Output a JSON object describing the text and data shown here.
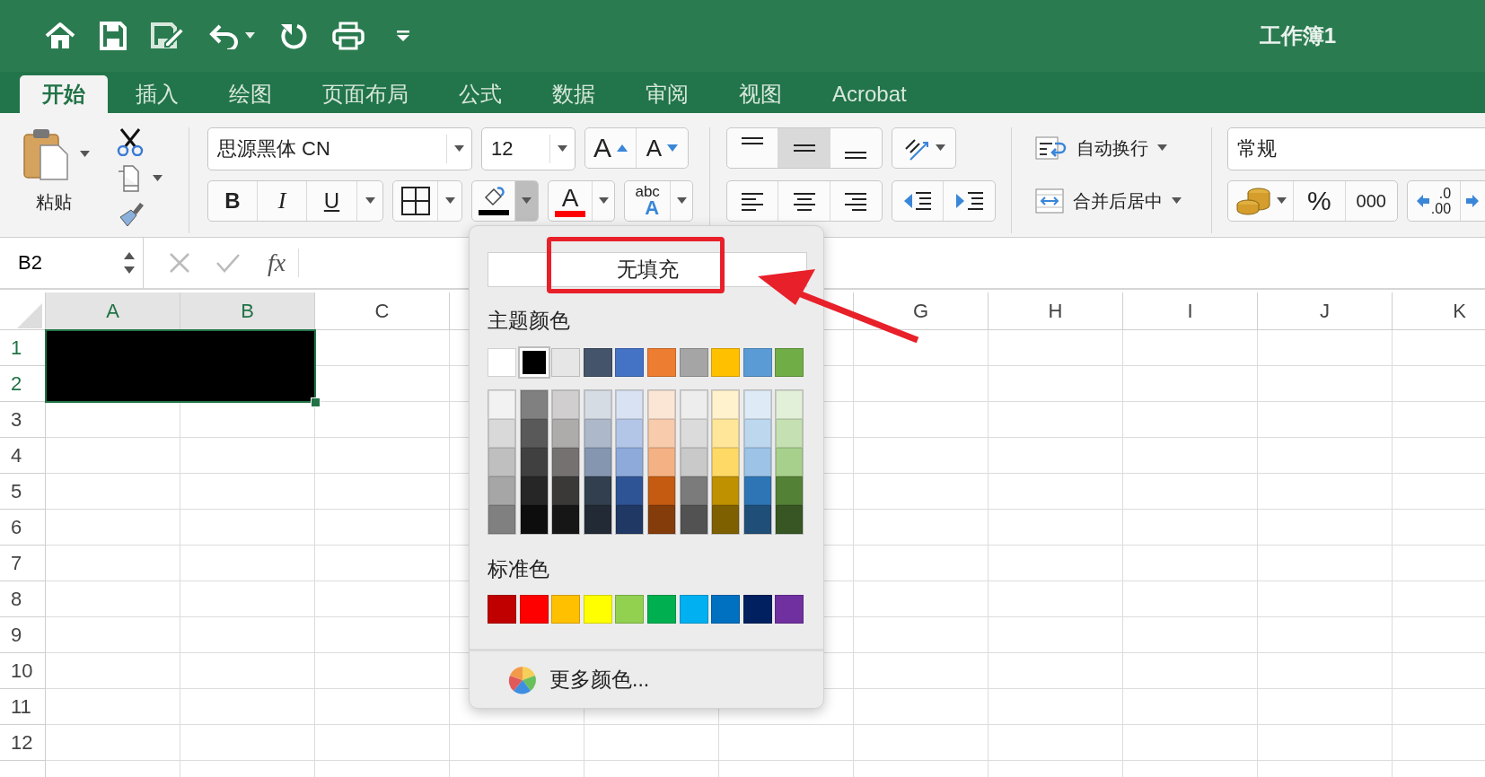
{
  "window": {
    "title": "工作簿1"
  },
  "tabs": [
    {
      "label": "开始",
      "selected": true
    },
    {
      "label": "插入",
      "selected": false
    },
    {
      "label": "绘图",
      "selected": false
    },
    {
      "label": "页面布局",
      "selected": false
    },
    {
      "label": "公式",
      "selected": false
    },
    {
      "label": "数据",
      "selected": false
    },
    {
      "label": "审阅",
      "selected": false
    },
    {
      "label": "视图",
      "selected": false
    },
    {
      "label": "Acrobat",
      "selected": false
    }
  ],
  "ribbon": {
    "paste": "粘贴",
    "font_name": "思源黑体 CN",
    "font_size": "12",
    "grow_font": "A",
    "shrink_font": "A",
    "bold": "B",
    "italic": "I",
    "underline": "U",
    "fill_color": {
      "color": "#000000",
      "open": true
    },
    "font_color": {
      "label": "A",
      "color": "#ff0000"
    },
    "text_effects": {
      "top": "abc",
      "bottom": "A"
    },
    "vertical_align": [
      {
        "selected": false
      },
      {
        "selected": true
      },
      {
        "selected": false
      }
    ],
    "wrap_text": "自动换行",
    "merge_center": "合并后居中",
    "number_format": "常规",
    "percent": "%",
    "thousands": "000",
    "decimal": {
      "top": ".0",
      "bottom": ".00"
    }
  },
  "formula_bar": {
    "name_box": "B2",
    "function": "fx"
  },
  "sheet": {
    "columns": [
      {
        "kind": "header",
        "label": "A",
        "selected": true
      },
      {
        "kind": "header",
        "label": "B",
        "selected": true
      },
      {
        "kind": "header",
        "label": "C",
        "selected": false
      },
      {
        "kind": "covered"
      },
      {
        "kind": "hidden"
      },
      {
        "kind": "covered"
      },
      {
        "kind": "header",
        "label": "G",
        "selected": false
      },
      {
        "kind": "header",
        "label": "H",
        "selected": false
      },
      {
        "kind": "header",
        "label": "I",
        "selected": false
      },
      {
        "kind": "header",
        "label": "J",
        "selected": false
      },
      {
        "kind": "header",
        "label": "K",
        "selected": false
      }
    ],
    "rows": [
      {
        "label": "1",
        "selected": true
      },
      {
        "label": "2",
        "selected": true
      },
      {
        "label": "3",
        "selected": false
      },
      {
        "label": "4",
        "selected": false
      },
      {
        "label": "5",
        "selected": false
      },
      {
        "label": "6",
        "selected": false
      },
      {
        "label": "7",
        "selected": false
      },
      {
        "label": "8",
        "selected": false
      },
      {
        "label": "9",
        "selected": false
      },
      {
        "label": "10",
        "selected": false
      },
      {
        "label": "11",
        "selected": false
      },
      {
        "label": "12",
        "selected": false
      }
    ]
  },
  "color_menu": {
    "no_fill": "无填充",
    "theme_heading": "主题颜色",
    "theme_colors": [
      {
        "color": "#ffffff",
        "selected": false
      },
      {
        "color": "#000000",
        "selected": true
      },
      {
        "color": "#e7e6e6",
        "selected": false
      },
      {
        "color": "#44546a",
        "selected": false
      },
      {
        "color": "#4472c4",
        "selected": false
      },
      {
        "color": "#ed7d31",
        "selected": false
      },
      {
        "color": "#a5a5a5",
        "selected": false
      },
      {
        "color": "#ffc000",
        "selected": false
      },
      {
        "color": "#5b9bd5",
        "selected": false
      },
      {
        "color": "#70ad47",
        "selected": false
      }
    ],
    "shade_columns": [
      {
        "shades": [
          {
            "color": "#f2f2f2"
          },
          {
            "color": "#d9d9d9"
          },
          {
            "color": "#bfbfbf"
          },
          {
            "color": "#a6a6a6"
          },
          {
            "color": "#808080"
          }
        ]
      },
      {
        "shades": [
          {
            "color": "#808080"
          },
          {
            "color": "#595959"
          },
          {
            "color": "#404040"
          },
          {
            "color": "#262626"
          },
          {
            "color": "#0d0d0d"
          }
        ]
      },
      {
        "shades": [
          {
            "color": "#d0cece"
          },
          {
            "color": "#aeabab"
          },
          {
            "color": "#757171"
          },
          {
            "color": "#3b3838"
          },
          {
            "color": "#161616"
          }
        ]
      },
      {
        "shades": [
          {
            "color": "#d6dce4"
          },
          {
            "color": "#adb9ca"
          },
          {
            "color": "#8496b0"
          },
          {
            "color": "#323f4f"
          },
          {
            "color": "#222a35"
          }
        ]
      },
      {
        "shades": [
          {
            "color": "#d9e2f3"
          },
          {
            "color": "#b4c6e7"
          },
          {
            "color": "#8eaadb"
          },
          {
            "color": "#2f5496"
          },
          {
            "color": "#1f3864"
          }
        ]
      },
      {
        "shades": [
          {
            "color": "#fbe5d5"
          },
          {
            "color": "#f7cbac"
          },
          {
            "color": "#f4b183"
          },
          {
            "color": "#c55a11"
          },
          {
            "color": "#843c0b"
          }
        ]
      },
      {
        "shades": [
          {
            "color": "#ededed"
          },
          {
            "color": "#dbdbdb"
          },
          {
            "color": "#c9c9c9"
          },
          {
            "color": "#7b7b7b"
          },
          {
            "color": "#525252"
          }
        ]
      },
      {
        "shades": [
          {
            "color": "#fff2cc"
          },
          {
            "color": "#ffe699"
          },
          {
            "color": "#ffd966"
          },
          {
            "color": "#bf9000"
          },
          {
            "color": "#7f6000"
          }
        ]
      },
      {
        "shades": [
          {
            "color": "#deebf6"
          },
          {
            "color": "#bdd7ee"
          },
          {
            "color": "#9dc3e6"
          },
          {
            "color": "#2e75b5"
          },
          {
            "color": "#1f4e79"
          }
        ]
      },
      {
        "shades": [
          {
            "color": "#e2efd9"
          },
          {
            "color": "#c5e0b3"
          },
          {
            "color": "#a8d08d"
          },
          {
            "color": "#538135"
          },
          {
            "color": "#375623"
          }
        ]
      }
    ],
    "standard_heading": "标准色",
    "standard_colors": [
      {
        "color": "#c00000"
      },
      {
        "color": "#ff0000"
      },
      {
        "color": "#ffc000"
      },
      {
        "color": "#ffff00"
      },
      {
        "color": "#92d050"
      },
      {
        "color": "#00b050"
      },
      {
        "color": "#00b0f0"
      },
      {
        "color": "#0070c0"
      },
      {
        "color": "#002060"
      },
      {
        "color": "#7030a0"
      }
    ],
    "more_colors": "更多颜色..."
  }
}
